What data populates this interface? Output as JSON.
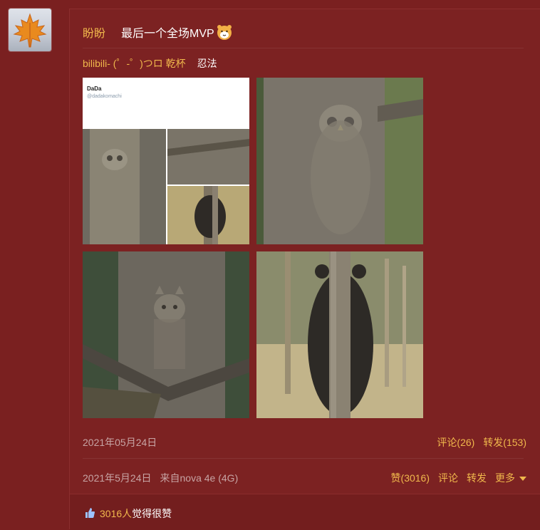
{
  "post": {
    "username": "盼盼",
    "text": "最后一个全场MVP",
    "emoji": "hamster-emoji",
    "repost_source": "bilibili- (゜-゜)つロ 乾杯",
    "repost_text": "忍法",
    "photos": [
      "owl-on-tree-screenshot",
      "great-grey-owl-on-tree",
      "cat-on-tree",
      "bear-behind-tree"
    ],
    "photo_header_name": "DaDa",
    "photo_header_handle": "@dadakomachi",
    "repost_date": "2021年05月24日",
    "repost_comment_label": "评论(26)",
    "repost_forward_label": "转发(153)",
    "post_date": "2021年5月24日",
    "post_source": "来自nova 4e (4G)",
    "like_label": "赞(3016)",
    "comment_label": "评论",
    "forward_label": "转发",
    "more_label": "更多",
    "likes_count": "3016人",
    "likes_text": "觉得很赞"
  },
  "colors": {
    "background": "#7a2020",
    "accent": "#f0b84c",
    "muted": "#c7a4a4"
  }
}
